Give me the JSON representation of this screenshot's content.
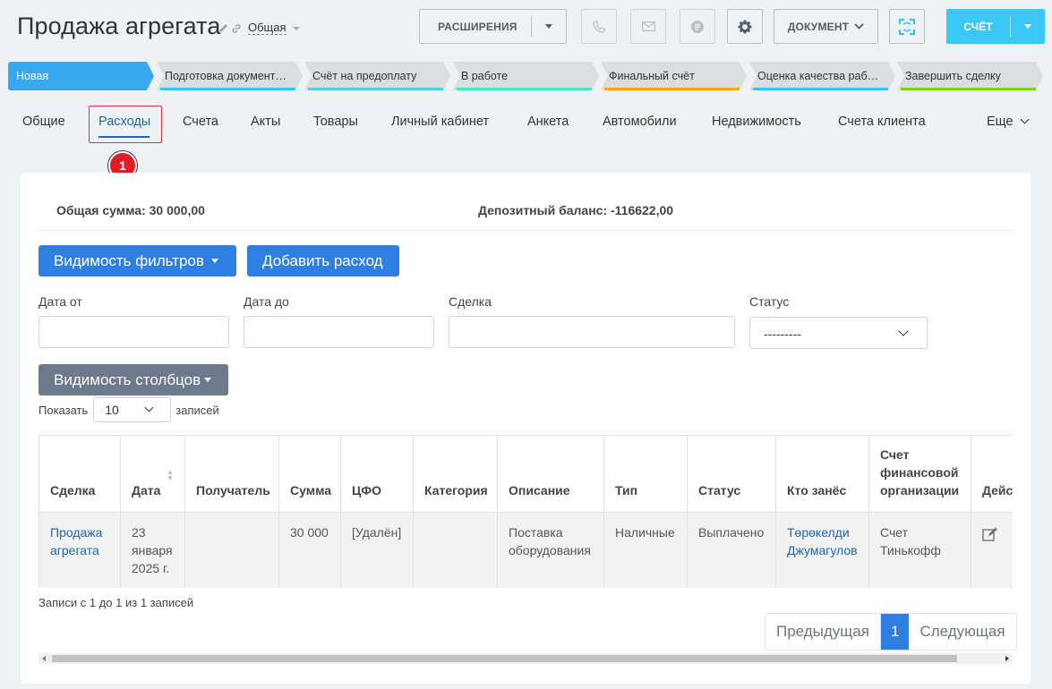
{
  "header": {
    "title": "Продажа агрегата",
    "category": "Общая",
    "extensions_label": "РАСШИРЕНИЯ",
    "document_label": "ДОКУМЕНТ",
    "invoice_label": "СЧЁТ"
  },
  "stages": [
    {
      "label": "Новая",
      "color": "#39a8ef",
      "active": true
    },
    {
      "label": "Подготовка документ…",
      "color": "#2fc6f6",
      "active": false
    },
    {
      "label": "Счёт на предоплату",
      "color": "#55d0e0",
      "active": false
    },
    {
      "label": "В работе",
      "color": "#47e4c2",
      "active": false
    },
    {
      "label": "Финальный счёт",
      "color": "#ffa900",
      "active": false
    },
    {
      "label": "Оценка качества раб…",
      "color": "#2fc6f6",
      "active": false
    },
    {
      "label": "Завершить сделку",
      "color": "#7bd500",
      "active": false
    }
  ],
  "tabs": [
    {
      "label": "Общие"
    },
    {
      "label": "Расходы"
    },
    {
      "label": "Счета"
    },
    {
      "label": "Акты"
    },
    {
      "label": "Товары"
    },
    {
      "label": "Личный кабинет"
    },
    {
      "label": "Анкета"
    },
    {
      "label": "Автомобили"
    },
    {
      "label": "Недвижимость"
    },
    {
      "label": "Счета клиента"
    },
    {
      "label": "Еще"
    }
  ],
  "annotation_marker": "1",
  "summary": {
    "total": "Общая сумма: 30 000,00",
    "deposit": "Депозитный баланс: -116622,00"
  },
  "buttons": {
    "filters_visibility": "Видимость фильтров",
    "add_expense": "Добавить расход",
    "columns_visibility": "Видимость столбцов"
  },
  "filters": {
    "date_from_label": "Дата от",
    "date_to_label": "Дата до",
    "deal_label": "Сделка",
    "status_label": "Статус",
    "status_value": "---------"
  },
  "length": {
    "show_label": "Показать",
    "value": "10",
    "records_label": "записей"
  },
  "table": {
    "columns": [
      "Сделка",
      "Дата",
      "Получатель",
      "Сумма",
      "ЦФО",
      "Категория",
      "Описание",
      "Тип",
      "Статус",
      "Кто занёс",
      "Счет финансовой организации",
      "Действия"
    ],
    "rows": [
      {
        "deal": "Продажа агрегата",
        "date": "23 января 2025 г.",
        "recipient": "",
        "amount": "30 000",
        "cfo": "[Удалён]",
        "category": "",
        "description": "Поставка оборудования",
        "type": "Наличные",
        "status": "Выплачено",
        "author": "Төрөкелди Джумагулов",
        "account": "Счет Тинькофф"
      }
    ]
  },
  "info": "Записи с 1 до 1 из 1 записей",
  "pagination": {
    "prev": "Предыдущая",
    "current": "1",
    "next": "Следующая"
  }
}
